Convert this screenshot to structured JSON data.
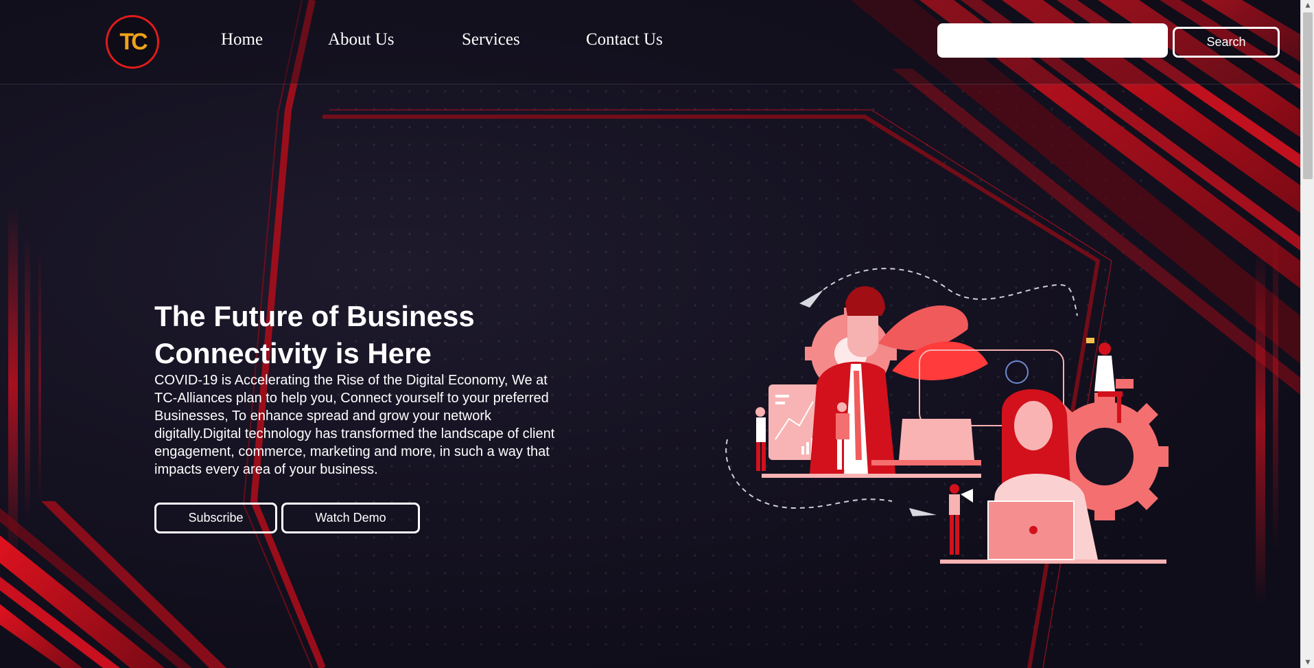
{
  "logo": {
    "text": "TC",
    "accent": "#e21b1b",
    "letters_color": "#f0a21a"
  },
  "nav": {
    "items": [
      {
        "label": "Home"
      },
      {
        "label": "About Us"
      },
      {
        "label": "Services"
      },
      {
        "label": "Contact Us"
      }
    ]
  },
  "search": {
    "value": "",
    "placeholder": "",
    "button_label": "Search"
  },
  "hero": {
    "title": "The Future of Business Connectivity is Here",
    "body": "COVID-19 is Accelerating the Rise of the Digital Economy, We at TC-Alliances plan to help you, Connect yourself to your preferred Businesses, To enhance spread and grow your network digitally.Digital technology has transformed the landscape of client engagement, commerce, marketing and more, in such a way that impacts every area of your business.",
    "subscribe_label": "Subscribe",
    "demo_label": "Watch Demo"
  },
  "colors": {
    "background": "#0f0d1c",
    "accent": "#c8101e",
    "illustration": "#f26b6b"
  },
  "icons": {
    "scroll_up": "▲",
    "scroll_down": "▼",
    "illustration": "business-people-illustration"
  }
}
